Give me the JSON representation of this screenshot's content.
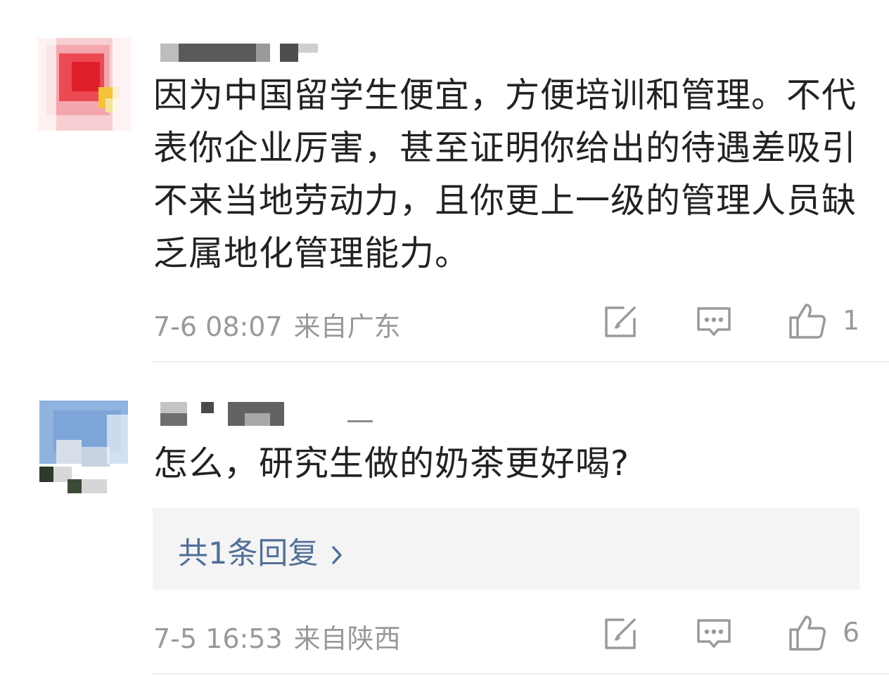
{
  "comments": [
    {
      "text": "因为中国留学生便宜，方便培训和管理。不代表你企业厉害，甚至证明你给出的待遇差吸引不来当地劳动力，且你更上一级的管理人员缺乏属地化管理能力。",
      "time": "7-6 08:07",
      "location": "来自广东",
      "likes": "1",
      "avatar_icon": "pixelated-avatar-red",
      "username_visible": false
    },
    {
      "text": "怎么，研究生做的奶茶更好喝?",
      "time": "7-5 16:53",
      "location": "来自陕西",
      "likes": "6",
      "reply_link": "共1条回复",
      "avatar_icon": "pixelated-avatar-blue",
      "username_visible": false
    }
  ],
  "icons": {
    "share": "edit-share-icon",
    "reply": "comment-bubble-icon",
    "like": "thumbs-up-icon",
    "chevron": "chevron-right-icon"
  },
  "colors": {
    "meta_text": "#999999",
    "link_blue": "#526f99",
    "reply_bg": "#f4f4f4"
  }
}
